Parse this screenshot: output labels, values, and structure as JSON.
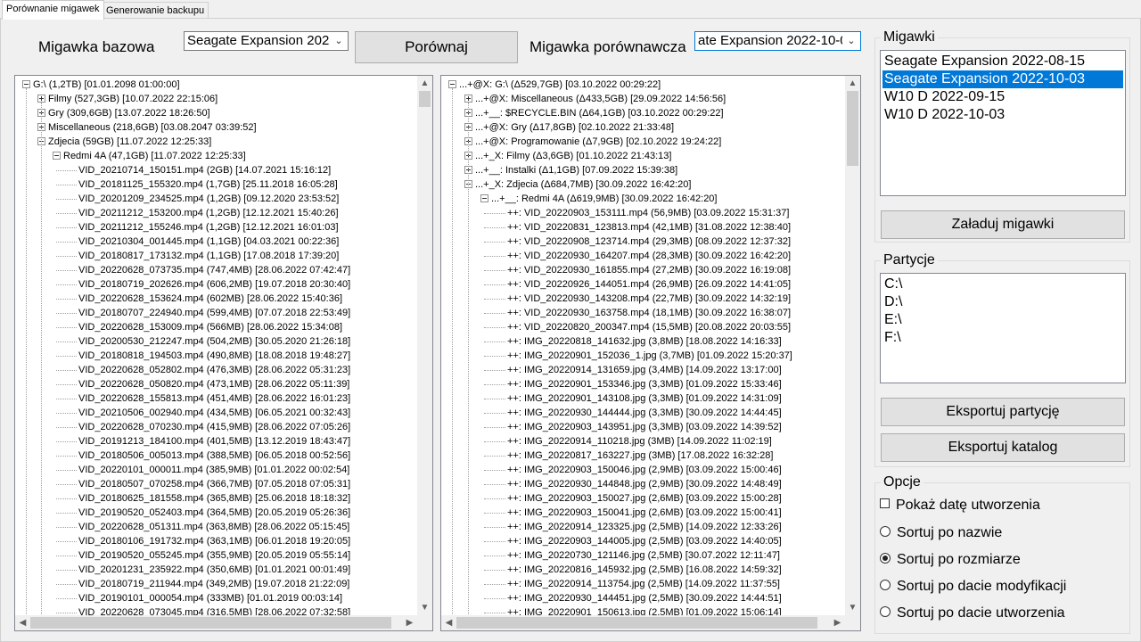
{
  "tabs": [
    {
      "label": "Porównanie migawek",
      "active": true
    },
    {
      "label": "Generowanie backupu",
      "active": false
    }
  ],
  "compare": {
    "base_label": "Migawka bazowa",
    "base_value": "Seagate Expansion 2022-",
    "compare_button": "Porównaj",
    "compare_label": "Migawka porównawcza",
    "compare_value": "ate Expansion 2022-10-03"
  },
  "left_tree": [
    {
      "level": 0,
      "expander": "minus",
      "text": "G:\\ (1,2TB) [01.01.2098 01:00:00]"
    },
    {
      "level": 1,
      "expander": "plus",
      "text": "Filmy (527,3GB) [10.07.2022 22:15:06]"
    },
    {
      "level": 1,
      "expander": "plus",
      "text": "Gry (309,6GB) [13.07.2022 18:26:50]"
    },
    {
      "level": 1,
      "expander": "plus",
      "text": "Miscellaneous (218,6GB) [03.08.2047 03:39:52]"
    },
    {
      "level": 1,
      "expander": "minus",
      "text": "Zdjecia (59GB) [11.07.2022 12:25:33]"
    },
    {
      "level": 2,
      "expander": "minus",
      "text": "Redmi 4A (47,1GB) [11.07.2022 12:25:33]"
    },
    {
      "level": 3,
      "expander": "none",
      "text": "VID_20210714_150151.mp4 (2GB) [14.07.2021 15:16:12]"
    },
    {
      "level": 3,
      "expander": "none",
      "text": "VID_20181125_155320.mp4 (1,7GB) [25.11.2018 16:05:28]"
    },
    {
      "level": 3,
      "expander": "none",
      "text": "VID_20201209_234525.mp4 (1,2GB) [09.12.2020 23:53:52]"
    },
    {
      "level": 3,
      "expander": "none",
      "text": "VID_20211212_153200.mp4 (1,2GB) [12.12.2021 15:40:26]"
    },
    {
      "level": 3,
      "expander": "none",
      "text": "VID_20211212_155246.mp4 (1,2GB) [12.12.2021 16:01:03]"
    },
    {
      "level": 3,
      "expander": "none",
      "text": "VID_20210304_001445.mp4 (1,1GB) [04.03.2021 00:22:36]"
    },
    {
      "level": 3,
      "expander": "none",
      "text": "VID_20180817_173132.mp4 (1,1GB) [17.08.2018 17:39:20]"
    },
    {
      "level": 3,
      "expander": "none",
      "text": "VID_20220628_073735.mp4 (747,4MB) [28.06.2022 07:42:47]"
    },
    {
      "level": 3,
      "expander": "none",
      "text": "VID_20180719_202626.mp4 (606,2MB) [19.07.2018 20:30:40]"
    },
    {
      "level": 3,
      "expander": "none",
      "text": "VID_20220628_153624.mp4 (602MB) [28.06.2022 15:40:36]"
    },
    {
      "level": 3,
      "expander": "none",
      "text": "VID_20180707_224940.mp4 (599,4MB) [07.07.2018 22:53:49]"
    },
    {
      "level": 3,
      "expander": "none",
      "text": "VID_20220628_153009.mp4 (566MB) [28.06.2022 15:34:08]"
    },
    {
      "level": 3,
      "expander": "none",
      "text": "VID_20200530_212247.mp4 (504,2MB) [30.05.2020 21:26:18]"
    },
    {
      "level": 3,
      "expander": "none",
      "text": "VID_20180818_194503.mp4 (490,8MB) [18.08.2018 19:48:27]"
    },
    {
      "level": 3,
      "expander": "none",
      "text": "VID_20220628_052802.mp4 (476,3MB) [28.06.2022 05:31:23]"
    },
    {
      "level": 3,
      "expander": "none",
      "text": "VID_20220628_050820.mp4 (473,1MB) [28.06.2022 05:11:39]"
    },
    {
      "level": 3,
      "expander": "none",
      "text": "VID_20220628_155813.mp4 (451,4MB) [28.06.2022 16:01:23]"
    },
    {
      "level": 3,
      "expander": "none",
      "text": "VID_20210506_002940.mp4 (434,5MB) [06.05.2021 00:32:43]"
    },
    {
      "level": 3,
      "expander": "none",
      "text": "VID_20220628_070230.mp4 (415,9MB) [28.06.2022 07:05:26]"
    },
    {
      "level": 3,
      "expander": "none",
      "text": "VID_20191213_184100.mp4 (401,5MB) [13.12.2019 18:43:47]"
    },
    {
      "level": 3,
      "expander": "none",
      "text": "VID_20180506_005013.mp4 (388,5MB) [06.05.2018 00:52:56]"
    },
    {
      "level": 3,
      "expander": "none",
      "text": "VID_20220101_000011.mp4 (385,9MB) [01.01.2022 00:02:54]"
    },
    {
      "level": 3,
      "expander": "none",
      "text": "VID_20180507_070258.mp4 (366,7MB) [07.05.2018 07:05:31]"
    },
    {
      "level": 3,
      "expander": "none",
      "text": "VID_20180625_181558.mp4 (365,8MB) [25.06.2018 18:18:32]"
    },
    {
      "level": 3,
      "expander": "none",
      "text": "VID_20190520_052403.mp4 (364,5MB) [20.05.2019 05:26:36]"
    },
    {
      "level": 3,
      "expander": "none",
      "text": "VID_20220628_051311.mp4 (363,8MB) [28.06.2022 05:15:45]"
    },
    {
      "level": 3,
      "expander": "none",
      "text": "VID_20180106_191732.mp4 (363,1MB) [06.01.2018 19:20:05]"
    },
    {
      "level": 3,
      "expander": "none",
      "text": "VID_20190520_055245.mp4 (355,9MB) [20.05.2019 05:55:14]"
    },
    {
      "level": 3,
      "expander": "none",
      "text": "VID_20201231_235922.mp4 (350,6MB) [01.01.2021 00:01:49]"
    },
    {
      "level": 3,
      "expander": "none",
      "text": "VID_20180719_211944.mp4 (349,2MB) [19.07.2018 21:22:09]"
    },
    {
      "level": 3,
      "expander": "none",
      "text": "VID_20190101_000054.mp4 (333MB) [01.01.2019 00:03:14]"
    },
    {
      "level": 3,
      "expander": "none",
      "text": "VID_20220628_073045.mp4 (316,5MB) [28.06.2022 07:32:58]"
    }
  ],
  "right_tree": [
    {
      "level": 0,
      "expander": "minus",
      "text": "...+@X: G:\\ (Δ529,7GB) [03.10.2022 00:29:22]"
    },
    {
      "level": 1,
      "expander": "plus",
      "text": "...+@X: Miscellaneous (Δ433,5GB) [29.09.2022 14:56:56]"
    },
    {
      "level": 1,
      "expander": "plus",
      "text": "...+__: $RECYCLE.BIN (Δ64,1GB) [03.10.2022 00:29:22]"
    },
    {
      "level": 1,
      "expander": "plus",
      "text": "...+@X: Gry (Δ17,8GB) [02.10.2022 21:33:48]"
    },
    {
      "level": 1,
      "expander": "plus",
      "text": "...+@X: Programowanie (Δ7,9GB) [02.10.2022 19:24:22]"
    },
    {
      "level": 1,
      "expander": "plus",
      "text": "...+_X: Filmy (Δ3,6GB) [01.10.2022 21:43:13]"
    },
    {
      "level": 1,
      "expander": "plus",
      "text": "...+__: Instalki (Δ1,1GB) [07.09.2022 15:39:38]"
    },
    {
      "level": 1,
      "expander": "minus",
      "text": "...+_X: Zdjecia (Δ684,7MB) [30.09.2022 16:42:20]"
    },
    {
      "level": 2,
      "expander": "minus",
      "text": "...+__: Redmi 4A (Δ619,9MB) [30.09.2022 16:42:20]"
    },
    {
      "level": 3,
      "expander": "none",
      "text": "++: VID_20220903_153111.mp4 (56,9MB) [03.09.2022 15:31:37]"
    },
    {
      "level": 3,
      "expander": "none",
      "text": "++: VID_20220831_123813.mp4 (42,1MB) [31.08.2022 12:38:40]"
    },
    {
      "level": 3,
      "expander": "none",
      "text": "++: VID_20220908_123714.mp4 (29,3MB) [08.09.2022 12:37:32]"
    },
    {
      "level": 3,
      "expander": "none",
      "text": "++: VID_20220930_164207.mp4 (28,3MB) [30.09.2022 16:42:20]"
    },
    {
      "level": 3,
      "expander": "none",
      "text": "++: VID_20220930_161855.mp4 (27,2MB) [30.09.2022 16:19:08]"
    },
    {
      "level": 3,
      "expander": "none",
      "text": "++: VID_20220926_144051.mp4 (26,9MB) [26.09.2022 14:41:05]"
    },
    {
      "level": 3,
      "expander": "none",
      "text": "++: VID_20220930_143208.mp4 (22,7MB) [30.09.2022 14:32:19]"
    },
    {
      "level": 3,
      "expander": "none",
      "text": "++: VID_20220930_163758.mp4 (18,1MB) [30.09.2022 16:38:07]"
    },
    {
      "level": 3,
      "expander": "none",
      "text": "++: VID_20220820_200347.mp4 (15,5MB) [20.08.2022 20:03:55]"
    },
    {
      "level": 3,
      "expander": "none",
      "text": "++: IMG_20220818_141632.jpg (3,8MB) [18.08.2022 14:16:33]"
    },
    {
      "level": 3,
      "expander": "none",
      "text": "++: IMG_20220901_152036_1.jpg (3,7MB) [01.09.2022 15:20:37]"
    },
    {
      "level": 3,
      "expander": "none",
      "text": "++: IMG_20220914_131659.jpg (3,4MB) [14.09.2022 13:17:00]"
    },
    {
      "level": 3,
      "expander": "none",
      "text": "++: IMG_20220901_153346.jpg (3,3MB) [01.09.2022 15:33:46]"
    },
    {
      "level": 3,
      "expander": "none",
      "text": "++: IMG_20220901_143108.jpg (3,3MB) [01.09.2022 14:31:09]"
    },
    {
      "level": 3,
      "expander": "none",
      "text": "++: IMG_20220930_144444.jpg (3,3MB) [30.09.2022 14:44:45]"
    },
    {
      "level": 3,
      "expander": "none",
      "text": "++: IMG_20220903_143951.jpg (3,3MB) [03.09.2022 14:39:52]"
    },
    {
      "level": 3,
      "expander": "none",
      "text": "++: IMG_20220914_110218.jpg (3MB) [14.09.2022 11:02:19]"
    },
    {
      "level": 3,
      "expander": "none",
      "text": "++: IMG_20220817_163227.jpg (3MB) [17.08.2022 16:32:28]"
    },
    {
      "level": 3,
      "expander": "none",
      "text": "++: IMG_20220903_150046.jpg (2,9MB) [03.09.2022 15:00:46]"
    },
    {
      "level": 3,
      "expander": "none",
      "text": "++: IMG_20220930_144848.jpg (2,9MB) [30.09.2022 14:48:49]"
    },
    {
      "level": 3,
      "expander": "none",
      "text": "++: IMG_20220903_150027.jpg (2,6MB) [03.09.2022 15:00:28]"
    },
    {
      "level": 3,
      "expander": "none",
      "text": "++: IMG_20220903_150041.jpg (2,6MB) [03.09.2022 15:00:41]"
    },
    {
      "level": 3,
      "expander": "none",
      "text": "++: IMG_20220914_123325.jpg (2,5MB) [14.09.2022 12:33:26]"
    },
    {
      "level": 3,
      "expander": "none",
      "text": "++: IMG_20220903_144005.jpg (2,5MB) [03.09.2022 14:40:05]"
    },
    {
      "level": 3,
      "expander": "none",
      "text": "++: IMG_20220730_121146.jpg (2,5MB) [30.07.2022 12:11:47]"
    },
    {
      "level": 3,
      "expander": "none",
      "text": "++: IMG_20220816_145932.jpg (2,5MB) [16.08.2022 14:59:32]"
    },
    {
      "level": 3,
      "expander": "none",
      "text": "++: IMG_20220914_113754.jpg (2,5MB) [14.09.2022 11:37:55]"
    },
    {
      "level": 3,
      "expander": "none",
      "text": "++: IMG_20220930_144451.jpg (2,5MB) [30.09.2022 14:44:51]"
    },
    {
      "level": 3,
      "expander": "none",
      "text": "++: IMG_20220901_150613.jpg (2,5MB) [01.09.2022 15:06:14]"
    }
  ],
  "snapshots": {
    "title": "Migawki",
    "items": [
      "Seagate Expansion 2022-08-15",
      "Seagate Expansion 2022-10-03",
      "W10 D 2022-09-15",
      "W10 D 2022-10-03"
    ],
    "selected_index": 1,
    "load_button": "Załaduj migawki"
  },
  "partitions": {
    "title": "Partycje",
    "items": [
      "C:\\",
      "D:\\",
      "E:\\",
      "F:\\"
    ],
    "export_partition_button": "Eksportuj partycję",
    "export_catalog_button": "Eksportuj katalog"
  },
  "options": {
    "title": "Opcje",
    "show_created_date": {
      "label": "Pokaż datę utworzenia",
      "checked": false
    },
    "sort_options": [
      "Sortuj po nazwie",
      "Sortuj po rozmiarze",
      "Sortuj po dacie modyfikacji",
      "Sortuj po dacie utworzenia"
    ],
    "sort_selected_index": 1
  },
  "colors": {
    "selection": "#0078d7",
    "window_bg": "#f0f0f0",
    "button_bg": "#e1e1e1"
  }
}
